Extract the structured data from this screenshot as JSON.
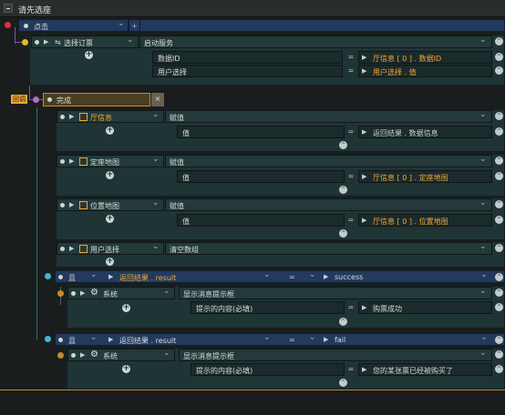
{
  "window": {
    "title": "请先选座"
  },
  "event1": {
    "label": "点击",
    "add": "+"
  },
  "action1": {
    "name": "选择订票",
    "action": "启动服务",
    "params": [
      {
        "name": "数据ID",
        "value": "厅信息 [ 0 ] . 数据ID"
      },
      {
        "name": "用户选择",
        "value": "用户选择 . 值"
      }
    ]
  },
  "callback": {
    "tag": "回调",
    "label": "完成",
    "close": "×"
  },
  "assign_blocks": [
    {
      "name": "厅信息",
      "action": "赋值",
      "param": "值",
      "value": "返回结果 . 数据信息",
      "value_color": "#d0d6d6"
    },
    {
      "name": "定座地图",
      "action": "赋值",
      "param": "值",
      "value": "厅信息 [ 0 ] . 定座地图",
      "value_color": "#f0a830"
    },
    {
      "name": "位置地图",
      "action": "赋值",
      "param": "值",
      "value": "厅信息 [ 0 ] . 位置地图",
      "value_color": "#f0a830"
    }
  ],
  "clear_block": {
    "name": "用户选择",
    "action": "清空数组"
  },
  "conditions": [
    {
      "op": "且",
      "left": "返回结果 . result",
      "eq": "=",
      "right": "success",
      "sys": "系统",
      "action": "显示消息提示框",
      "param": "提示的内容(必填)",
      "value": "购票成功"
    },
    {
      "op": "且",
      "left": "返回结果 . result",
      "eq": "=",
      "right": "fail",
      "sys": "系统",
      "action": "显示消息提示框",
      "param": "提示的内容(必填)",
      "value": "您的某张票已经被购买了"
    }
  ],
  "symbols": {
    "eq": "=",
    "chev": "⌄",
    "tri": "▶",
    "plus": "+",
    "up": "^"
  },
  "colors": {
    "accent": "#f0a830",
    "link": "#7a5aa0",
    "bar": "#233a5d",
    "row": "#23393a"
  }
}
